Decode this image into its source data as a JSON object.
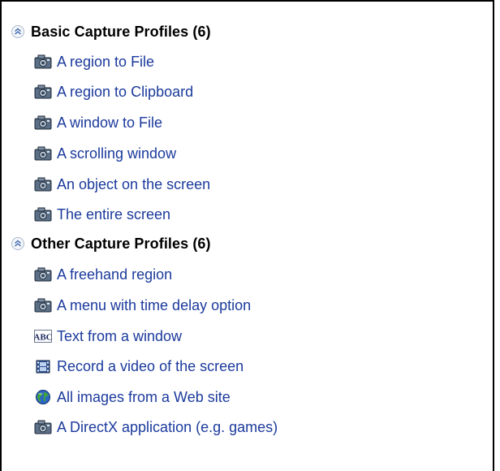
{
  "groups": [
    {
      "title": "Basic Capture Profiles (6)",
      "items": [
        {
          "label": "A region to File",
          "icon": "camera-icon"
        },
        {
          "label": "A region to Clipboard",
          "icon": "camera-icon"
        },
        {
          "label": "A window to File",
          "icon": "camera-icon"
        },
        {
          "label": "A scrolling window",
          "icon": "camera-icon"
        },
        {
          "label": "An object on the screen",
          "icon": "camera-icon"
        },
        {
          "label": "The entire screen",
          "icon": "camera-icon"
        }
      ]
    },
    {
      "title": "Other Capture Profiles (6)",
      "items": [
        {
          "label": "A freehand region",
          "icon": "camera-icon"
        },
        {
          "label": "A menu with time delay option",
          "icon": "camera-icon"
        },
        {
          "label": "Text from a window",
          "icon": "text-abc-icon"
        },
        {
          "label": "Record a video of the screen",
          "icon": "film-icon"
        },
        {
          "label": "All images from a Web site",
          "icon": "globe-icon"
        },
        {
          "label": "A DirectX application (e.g. games)",
          "icon": "camera-icon"
        }
      ]
    }
  ],
  "colors": {
    "link": "#1b3a9c",
    "header_text": "#000000",
    "border": "#000000"
  }
}
